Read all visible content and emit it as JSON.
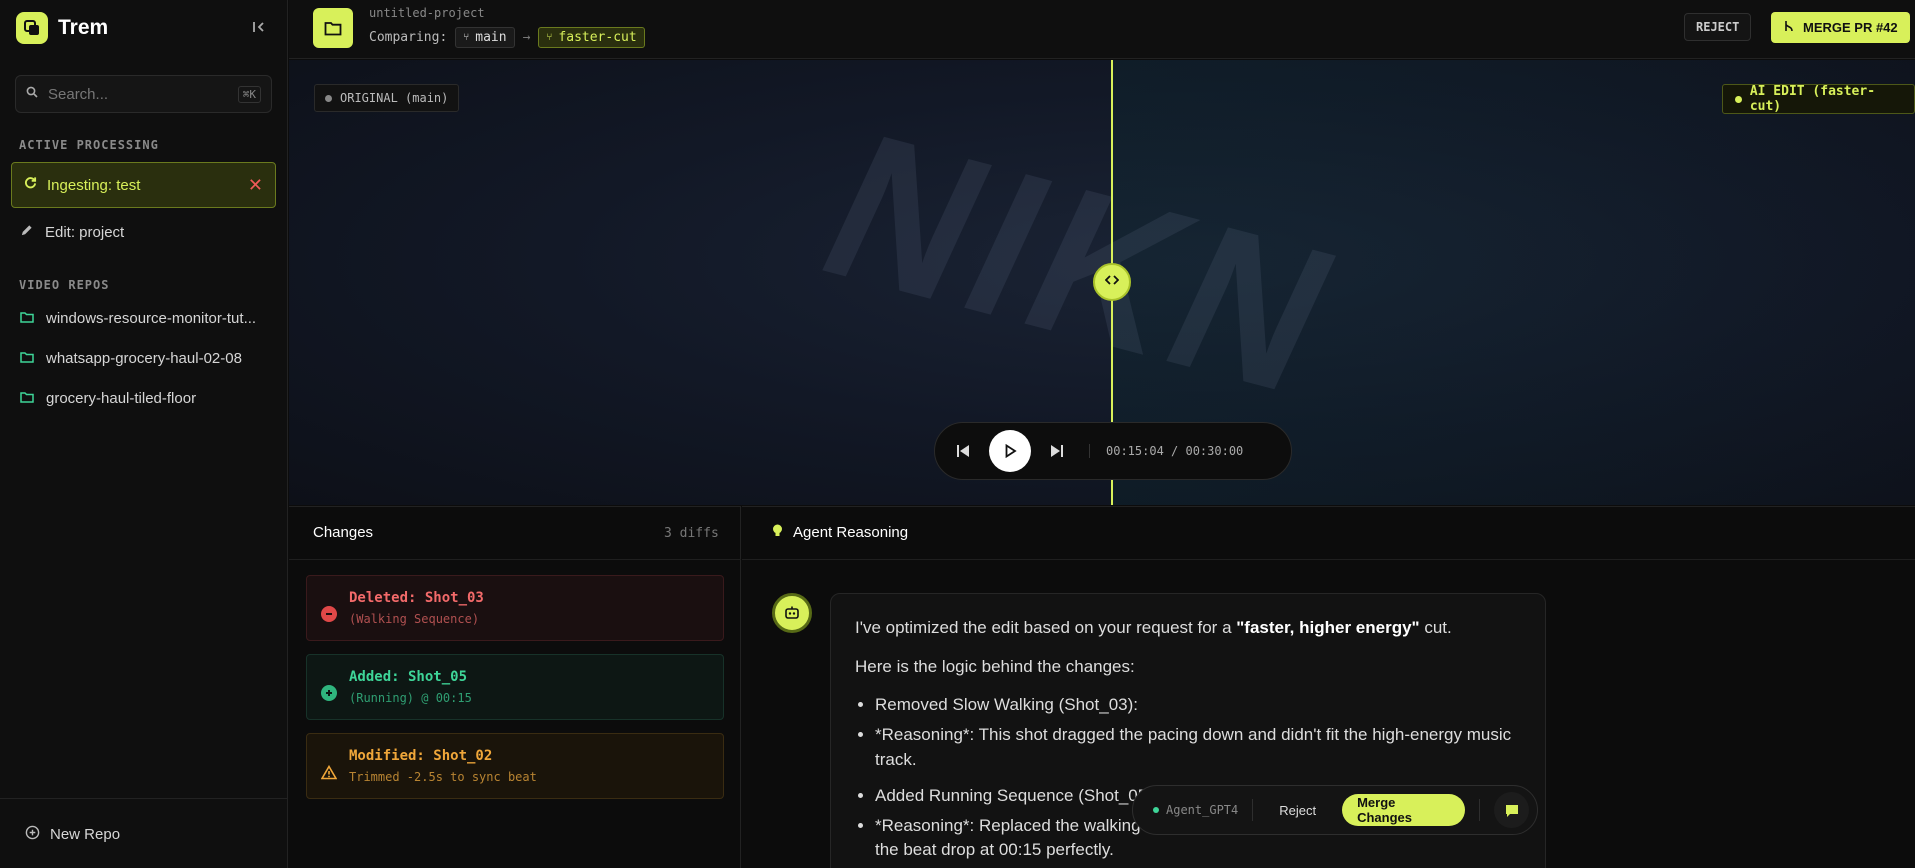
{
  "brand": {
    "name": "Trem",
    "logo_icon": "layers-icon"
  },
  "sidebar": {
    "search": {
      "placeholder": "Search...",
      "shortcut": "⌘K"
    },
    "active_label": "ACTIVE PROCESSING",
    "active_item": {
      "label": "Ingesting: test"
    },
    "edit_item": {
      "label": "Edit: project"
    },
    "repos_label": "VIDEO REPOS",
    "repos": [
      {
        "label": "windows-resource-monitor-tut..."
      },
      {
        "label": "whatsapp-grocery-haul-02-08"
      },
      {
        "label": "grocery-haul-tiled-floor"
      }
    ],
    "new_repo_label": "New Repo"
  },
  "header": {
    "project_name": "untitled-project",
    "comparing_label": "Comparing:",
    "base_branch": "main",
    "arrow": "→",
    "target_branch": "faster-cut",
    "reject_label": "REJECT",
    "merge_label": "MERGE PR #42"
  },
  "video": {
    "original_tag": "ORIGINAL (main)",
    "ai_tag": "AI EDIT (faster-cut)",
    "watermark": "NIKN",
    "timecode": "00:15:04 / 00:30:00"
  },
  "changes": {
    "title": "Changes",
    "count": "3 diffs",
    "items": [
      {
        "title": "Deleted: Shot_03",
        "sub": "(Walking Sequence)"
      },
      {
        "title": "Added: Shot_05",
        "sub": "(Running) @ 00:15"
      },
      {
        "title": "Modified: Shot_02",
        "sub": "Trimmed -2.5s to sync beat"
      }
    ]
  },
  "agent": {
    "title": "Agent Reasoning",
    "intro_pre": "I've optimized the edit based on your request for a ",
    "intro_bold": "\"faster, higher energy\"",
    "intro_post": " cut.",
    "logic": "Here is the logic behind the changes:",
    "bullets": [
      "Removed Slow Walking (Shot_03):",
      "*Reasoning*: This shot dragged the pacing down and didn't fit the high-energy music track.",
      "Added Running Sequence (Shot_05 @ 00:15):",
      "*Reasoning*: Replaced the walking shot with this dynamic running angle. It matches the beat drop at 00:15 perfectly."
    ],
    "action_bar": {
      "agent_name": "Agent_GPT4",
      "reject_label": "Reject",
      "merge_label": "Merge Changes"
    }
  },
  "colors": {
    "accent": "#d8f05a",
    "deleted": "#f36a6a",
    "added": "#3ed598",
    "modified": "#f0a73a"
  }
}
